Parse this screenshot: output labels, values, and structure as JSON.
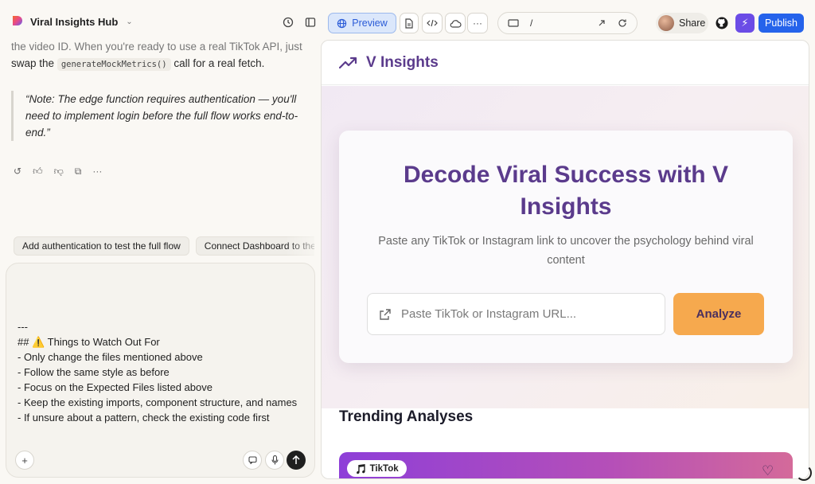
{
  "topbar": {
    "project_name": "Viral Insights Hub",
    "preview_label": "Preview",
    "url_path": "/",
    "share_label": "Share",
    "publish_label": "Publish"
  },
  "chat": {
    "intro_fade": "the video ID. When you're ready to use a real TikTok API, just",
    "intro_line2_a": "swap the",
    "intro_code": "generateMockMetrics()",
    "intro_line2_b": "call for a real fetch.",
    "note": "“Note: The edge function requires authentication — you'll need to implement login before the full flow works end-to-end.”",
    "suggestions": [
      "Add authentication to test the full flow",
      "Connect Dashboard to the"
    ],
    "composer_text": "---\n## ⚠️ Things to Watch Out For\n- Only change the files mentioned above\n- Follow the same style as before\n- Focus on the Expected Files listed above\n- Keep the existing imports, component structure, and names\n- If unsure about a pattern, check the existing code first"
  },
  "preview": {
    "app_name": "V Insights",
    "hero_title": "Decode Viral Success with V Insights",
    "hero_subtitle": "Paste any TikTok or Instagram link to uncover the psychology behind viral content",
    "url_placeholder": "Paste TikTok or Instagram URL...",
    "analyze_label": "Analyze",
    "trending_title": "Trending Analyses",
    "trend_platform": "TikTok"
  },
  "colors": {
    "brand_purple": "#5b3b8c",
    "analyze_orange": "#f6a94e",
    "publish_blue": "#2563eb"
  }
}
